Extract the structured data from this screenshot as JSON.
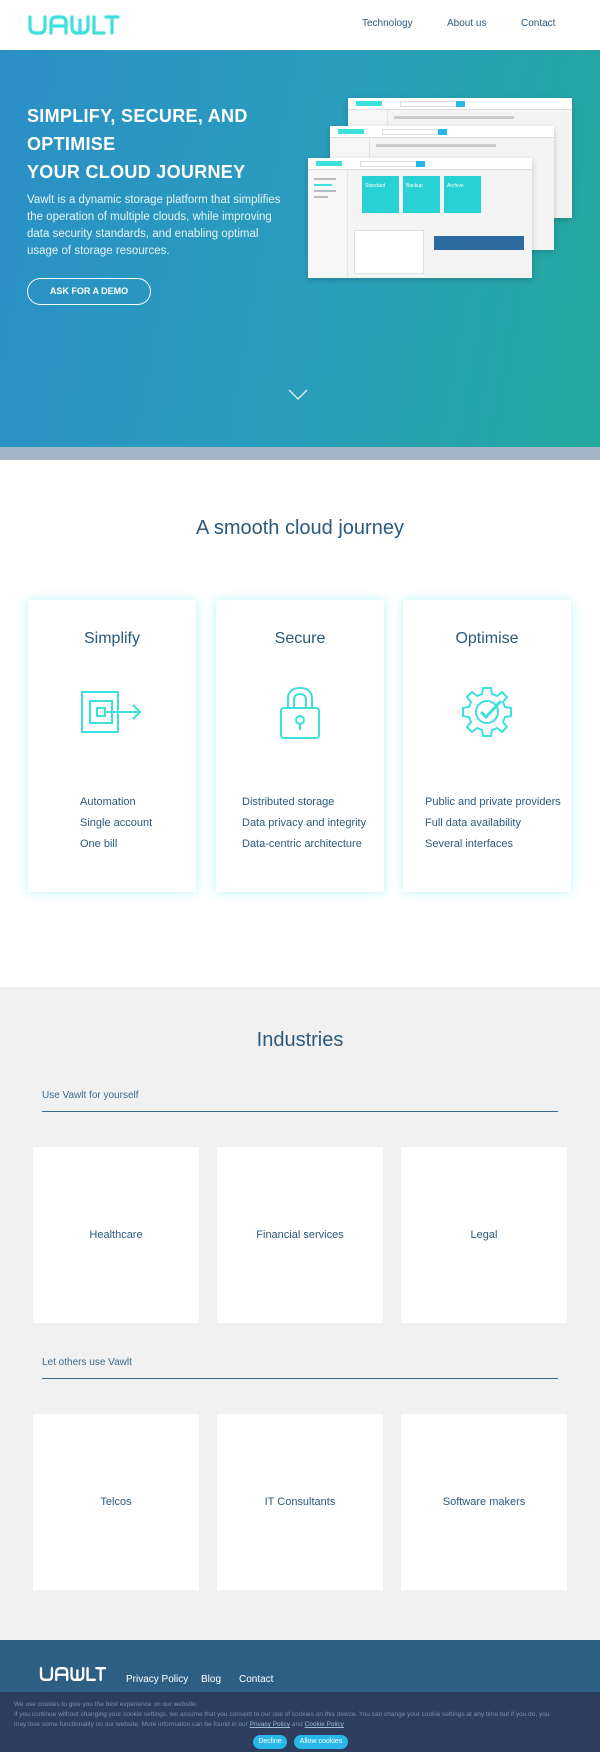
{
  "header": {
    "logo": "VAWLT",
    "nav": [
      "Technology",
      "About us",
      "Contact"
    ]
  },
  "hero": {
    "title_line1": "SIMPLIFY, SECURE, AND",
    "title_line2": "OPTIMISE",
    "title_line3": "YOUR CLOUD JOURNEY",
    "description": "Vawlt is a dynamic storage platform that simplifies the operation of multiple clouds, while improving data security standards, and enabling optimal usage of storage resources.",
    "cta": "ASK FOR A DEMO",
    "mockup_labels": {
      "tile1": "Standard",
      "tile2": "Backup",
      "tile3": "Archive"
    }
  },
  "journey": {
    "title": "A smooth cloud journey",
    "cards": [
      {
        "title": "Simplify",
        "icon": "box-arrow-icon",
        "features": [
          "Automation",
          "Single account",
          "One bill"
        ]
      },
      {
        "title": "Secure",
        "icon": "padlock-icon",
        "features": [
          "Distributed storage",
          "Data privacy and integrity",
          "Data-centric architecture"
        ]
      },
      {
        "title": "Optimise",
        "icon": "gear-check-icon",
        "features": [
          "Public and private providers",
          "Full data availability",
          "Several interfaces"
        ]
      }
    ]
  },
  "industries": {
    "title": "Industries",
    "group1_label": "Use Vawlt for yourself",
    "group1": [
      "Healthcare",
      "Financial services",
      "Legal"
    ],
    "group2_label": "Let others use Vawlt",
    "group2": [
      "Telcos",
      "IT Consultants",
      "Software makers"
    ]
  },
  "footer": {
    "logo": "VAWLT",
    "links": [
      "Privacy Policy",
      "Blog",
      "Contact"
    ]
  },
  "cookie": {
    "line1": "We use cookies to give you the best experience on our website.",
    "line2": "If you continue without changing your cookie settings, we assume that you consent to our use of cookies on this device. You can change your cookie settings at any time but if you do, you",
    "line3a": "may lose some functionality on our website. More information can be found in our",
    "privacy_link": "Privacy Policy",
    "and": "and",
    "cookie_link": "Cookie Policy",
    "decline": "Decline",
    "allow": "Allow cookies"
  },
  "colors": {
    "accent": "#3ee0dc",
    "brand": "#2b5a7d",
    "hero_start": "#2b8fc6",
    "hero_end": "#24a99f",
    "footer": "#2d5f85",
    "cookie_bg": "#2c3d5e",
    "cookie_button": "#29b6e8"
  }
}
